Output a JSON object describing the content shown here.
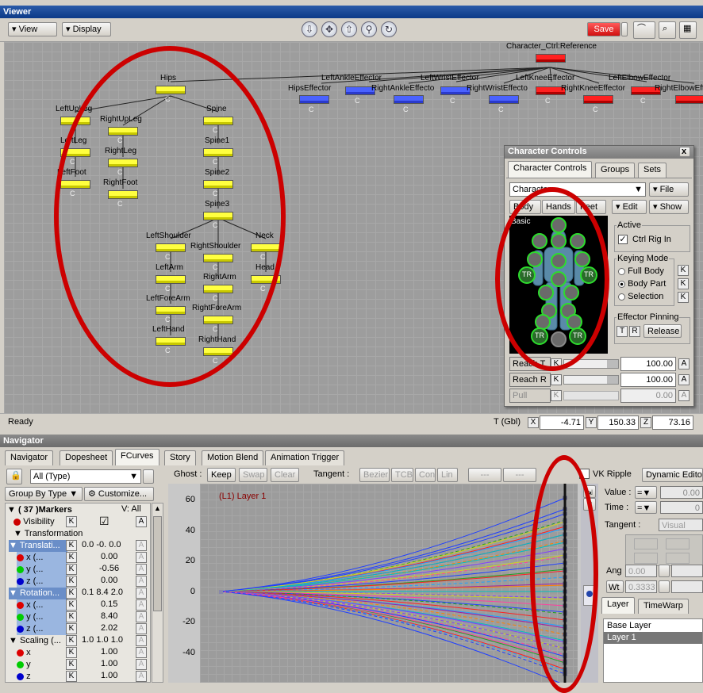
{
  "viewer": {
    "title": "Viewer",
    "view_menu": "View",
    "display_menu": "Display",
    "save": "Save",
    "status": "Ready",
    "coords": {
      "label": "T (Gbl)",
      "x_label": "X",
      "x": "-4.71",
      "y_label": "Y",
      "y": "150.33",
      "z_label": "Z",
      "z": "73.16"
    },
    "reference_node": "Character_Ctrl:Reference",
    "effectors": [
      {
        "label": "LeftAnkleEffector"
      },
      {
        "label": "LeftWristEffector"
      },
      {
        "label": "LeftKneeEffector"
      },
      {
        "label": "LeftElbowEffector"
      },
      {
        "label": "HipsEffector"
      },
      {
        "label": "RightAnkleEffecto"
      },
      {
        "label": "RightWristEffecto"
      },
      {
        "label": "RightKneeEffector"
      },
      {
        "label": "RightElbowEffecto"
      }
    ],
    "skeleton": [
      "Hips",
      "LeftUpLeg",
      "RightUpLeg",
      "LeftLeg",
      "RightLeg",
      "LeftFoot",
      "RightFoot",
      "Spine",
      "Spine1",
      "Spine2",
      "Spine3",
      "LeftShoulder",
      "RightShoulder",
      "Neck",
      "Head",
      "LeftArm",
      "RightArm",
      "LeftForeArm",
      "RightForeArm",
      "LeftHand",
      "RightHand"
    ],
    "c_label": "C"
  },
  "character_controls": {
    "title": "Character Controls",
    "close": "x",
    "tabs": [
      "Character Controls",
      "Groups",
      "Sets"
    ],
    "character_select": "Character",
    "file_menu": "File",
    "subtabs": [
      "Body",
      "Hands",
      "Feet"
    ],
    "edit_menu": "Edit",
    "show_menu": "Show",
    "figure_label": "Basic",
    "tr": "TR",
    "active_group": "Active",
    "ctrl_rig_in": "Ctrl Rig In",
    "keying_mode": "Keying Mode",
    "modes": [
      "Full Body",
      "Body Part",
      "Selection"
    ],
    "selected_mode": "Body Part",
    "k": "K",
    "effector_pinning": "Effector Pinning",
    "pin_t": "T",
    "pin_r": "R",
    "release": "Release",
    "reach_rows": [
      {
        "label": "Reach T",
        "value": "100.00"
      },
      {
        "label": "Reach R",
        "value": "100.00"
      },
      {
        "label": "Pull",
        "value": "0.00"
      }
    ],
    "a": "A"
  },
  "navigator": {
    "title": "Navigator",
    "tabs": [
      "Navigator",
      "Dopesheet",
      "FCurves",
      "Story",
      "Motion Blend",
      "Animation Trigger"
    ],
    "active_tab": "FCurves",
    "type_filter": "All (Type)",
    "group_by": "Group By Type",
    "customize": "Customize...",
    "markers_header": "( 37 )Markers",
    "v_all": "V: All",
    "visibility": "Visibility",
    "transformation": "Transformation",
    "translation": {
      "label": "Translati...",
      "values": "0.0 -0. 0.0",
      "x": "x (...",
      "x_val": "0.00",
      "y": "y (...",
      "y_val": "-0.56",
      "z": "z (...",
      "z_val": "0.00"
    },
    "rotation": {
      "label": "Rotation...",
      "values": "0.1 8.4 2.0",
      "x": "x (...",
      "x_val": "0.15",
      "y": "y (...",
      "y_val": "8.40",
      "z": "z (...",
      "z_val": "2.02"
    },
    "scaling": {
      "label": "Scaling (...",
      "values": "1.0 1.0 1.0",
      "x": "x",
      "x_val": "1.00",
      "y": "y",
      "y_val": "1.00",
      "z": "z",
      "z_val": "1.00"
    },
    "toolbar": {
      "ghost": "Ghost :",
      "keep": "Keep",
      "swap": "Swap",
      "clear": "Clear",
      "tangent": "Tangent :",
      "bezier": "Bezier",
      "tcb": "TCB",
      "con": "Con",
      "lin": "Lin",
      "dash1": "---",
      "dash2": "---",
      "vk_ripple": "VK Ripple",
      "dynamic": "Dynamic Edito"
    },
    "layer_label": "(L1) Layer 1",
    "yticks": [
      "60",
      "40",
      "20",
      "0",
      "-20",
      "-40"
    ],
    "right": {
      "value": "Value :",
      "time": "Time :",
      "value_num": "0.00",
      "time_num": "0",
      "tangent": "Tangent :",
      "visual": "Visual",
      "ang": "Ang",
      "ang_val": "0.00",
      "wt": "Wt",
      "wt_val": "0.3333",
      "eq": "="
    },
    "layer_tabs": [
      "Layer",
      "TimeWarp"
    ],
    "layers": [
      "Base Layer",
      "Layer 1"
    ],
    "selected_layer": "Layer 1"
  },
  "colors": {
    "accent_red": "#cc0000",
    "node_yellow": "#ffff40",
    "node_blue": "#4a62ff",
    "title_blue": "#1a4a98"
  }
}
